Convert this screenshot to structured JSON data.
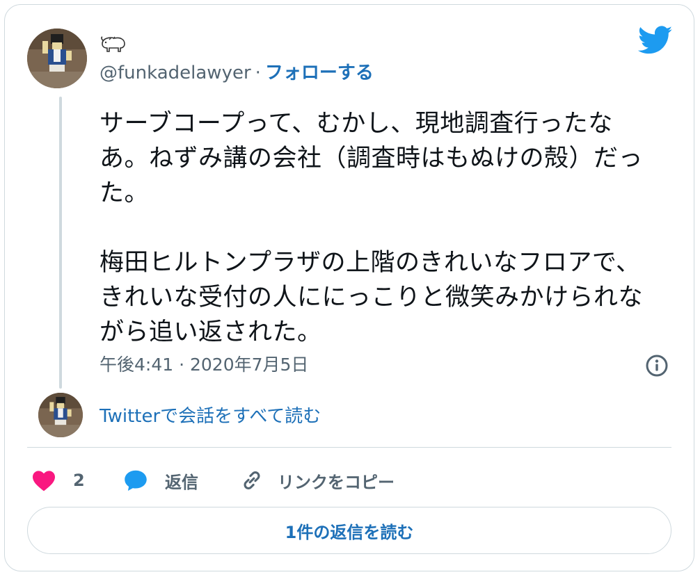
{
  "author": {
    "display_name_emoji": "🐃",
    "handle": "@funkadelawyer",
    "separator": "·",
    "follow_label": "フォローする"
  },
  "tweet": {
    "text": "サーブコープって、むかし、現地調査行ったなあ。ねずみ講の会社（調査時はもぬけの殻）だった。\n\n梅田ヒルトンプラザの上階のきれいなフロアで、きれいな受付の人ににっこりと微笑みかけられながら追い返された。",
    "timestamp": "午後4:41 · 2020年7月5日"
  },
  "conversation": {
    "read_label": "Twitterで会話をすべて読む"
  },
  "actions": {
    "like_count": "2",
    "reply_label": "返信",
    "copy_link_label": "リンクをコピー"
  },
  "replies_button": {
    "label": "1件の返信を読む"
  },
  "icons": {
    "twitter": "twitter-bird-icon",
    "info": "info-icon",
    "like": "heart-icon",
    "reply": "speech-bubble-icon",
    "link": "link-icon"
  },
  "colors": {
    "accent": "#1d70b8",
    "twitter_blue": "#1d9bf0",
    "like": "#f91880",
    "muted": "#536471",
    "border": "#cfd9de"
  }
}
